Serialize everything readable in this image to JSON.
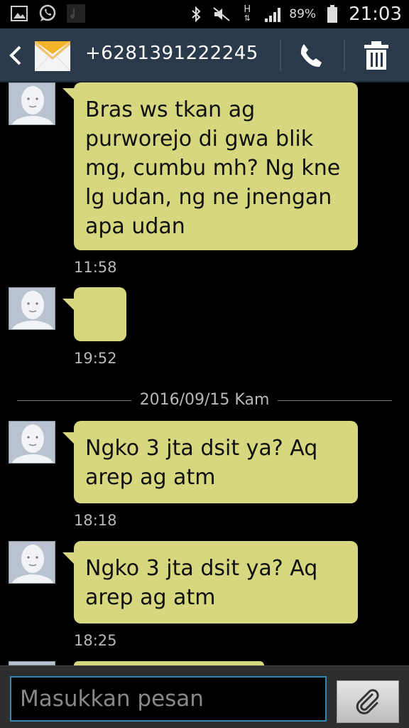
{
  "status_bar": {
    "left_icons": [
      "gallery-icon",
      "whatsapp-icon",
      "music-icon"
    ],
    "right_icons": [
      "bluetooth-icon",
      "mute-icon",
      "hplus-data-icon",
      "signal-icon",
      "battery-icon"
    ],
    "network_type": "H",
    "battery_percent": "89%",
    "time": "21:03"
  },
  "action_bar": {
    "title": "+6281391222245",
    "icons": [
      "back-icon",
      "envelope-icon",
      "call-icon",
      "delete-icon"
    ]
  },
  "messages": [
    {
      "text": "Bras ws tkan ag purworejo di gwa blik mg, cumbu mh? Ng kne lg udan, ng ne jnengan apa udan",
      "time": "11:58"
    },
    {
      "text": "",
      "time": "19:52"
    },
    {
      "text": "Ngko 3 jta dsit ya? Aq arep ag atm",
      "time": "18:18"
    },
    {
      "text": "Ngko 3 jta dsit ya? Aq arep ag atm",
      "time": "18:25"
    }
  ],
  "date_separator": "2016/09/15 Kam",
  "compose": {
    "placeholder": "Masukkan pesan",
    "attach_icon": "paperclip-icon"
  },
  "colors": {
    "bubble": "#d7d77f",
    "action_bar": "#2a3a4a",
    "input_border": "#2f88b8"
  }
}
